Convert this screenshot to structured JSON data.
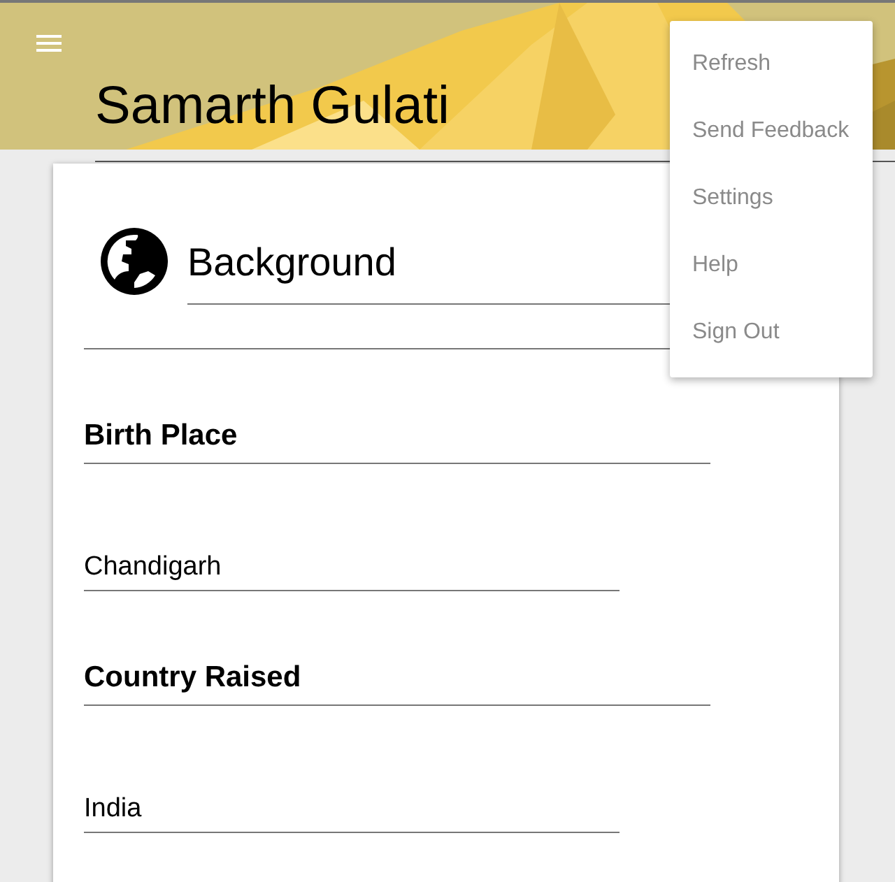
{
  "header": {
    "title": "Samarth Gulati"
  },
  "card": {
    "title": "Background",
    "fields": [
      {
        "label": "Birth Place",
        "value": "Chandigarh"
      },
      {
        "label": "Country Raised",
        "value": "India"
      }
    ]
  },
  "menu": {
    "items": [
      {
        "label": "Refresh"
      },
      {
        "label": "Send Feedback"
      },
      {
        "label": "Settings"
      },
      {
        "label": "Help"
      },
      {
        "label": "Sign Out"
      }
    ]
  }
}
